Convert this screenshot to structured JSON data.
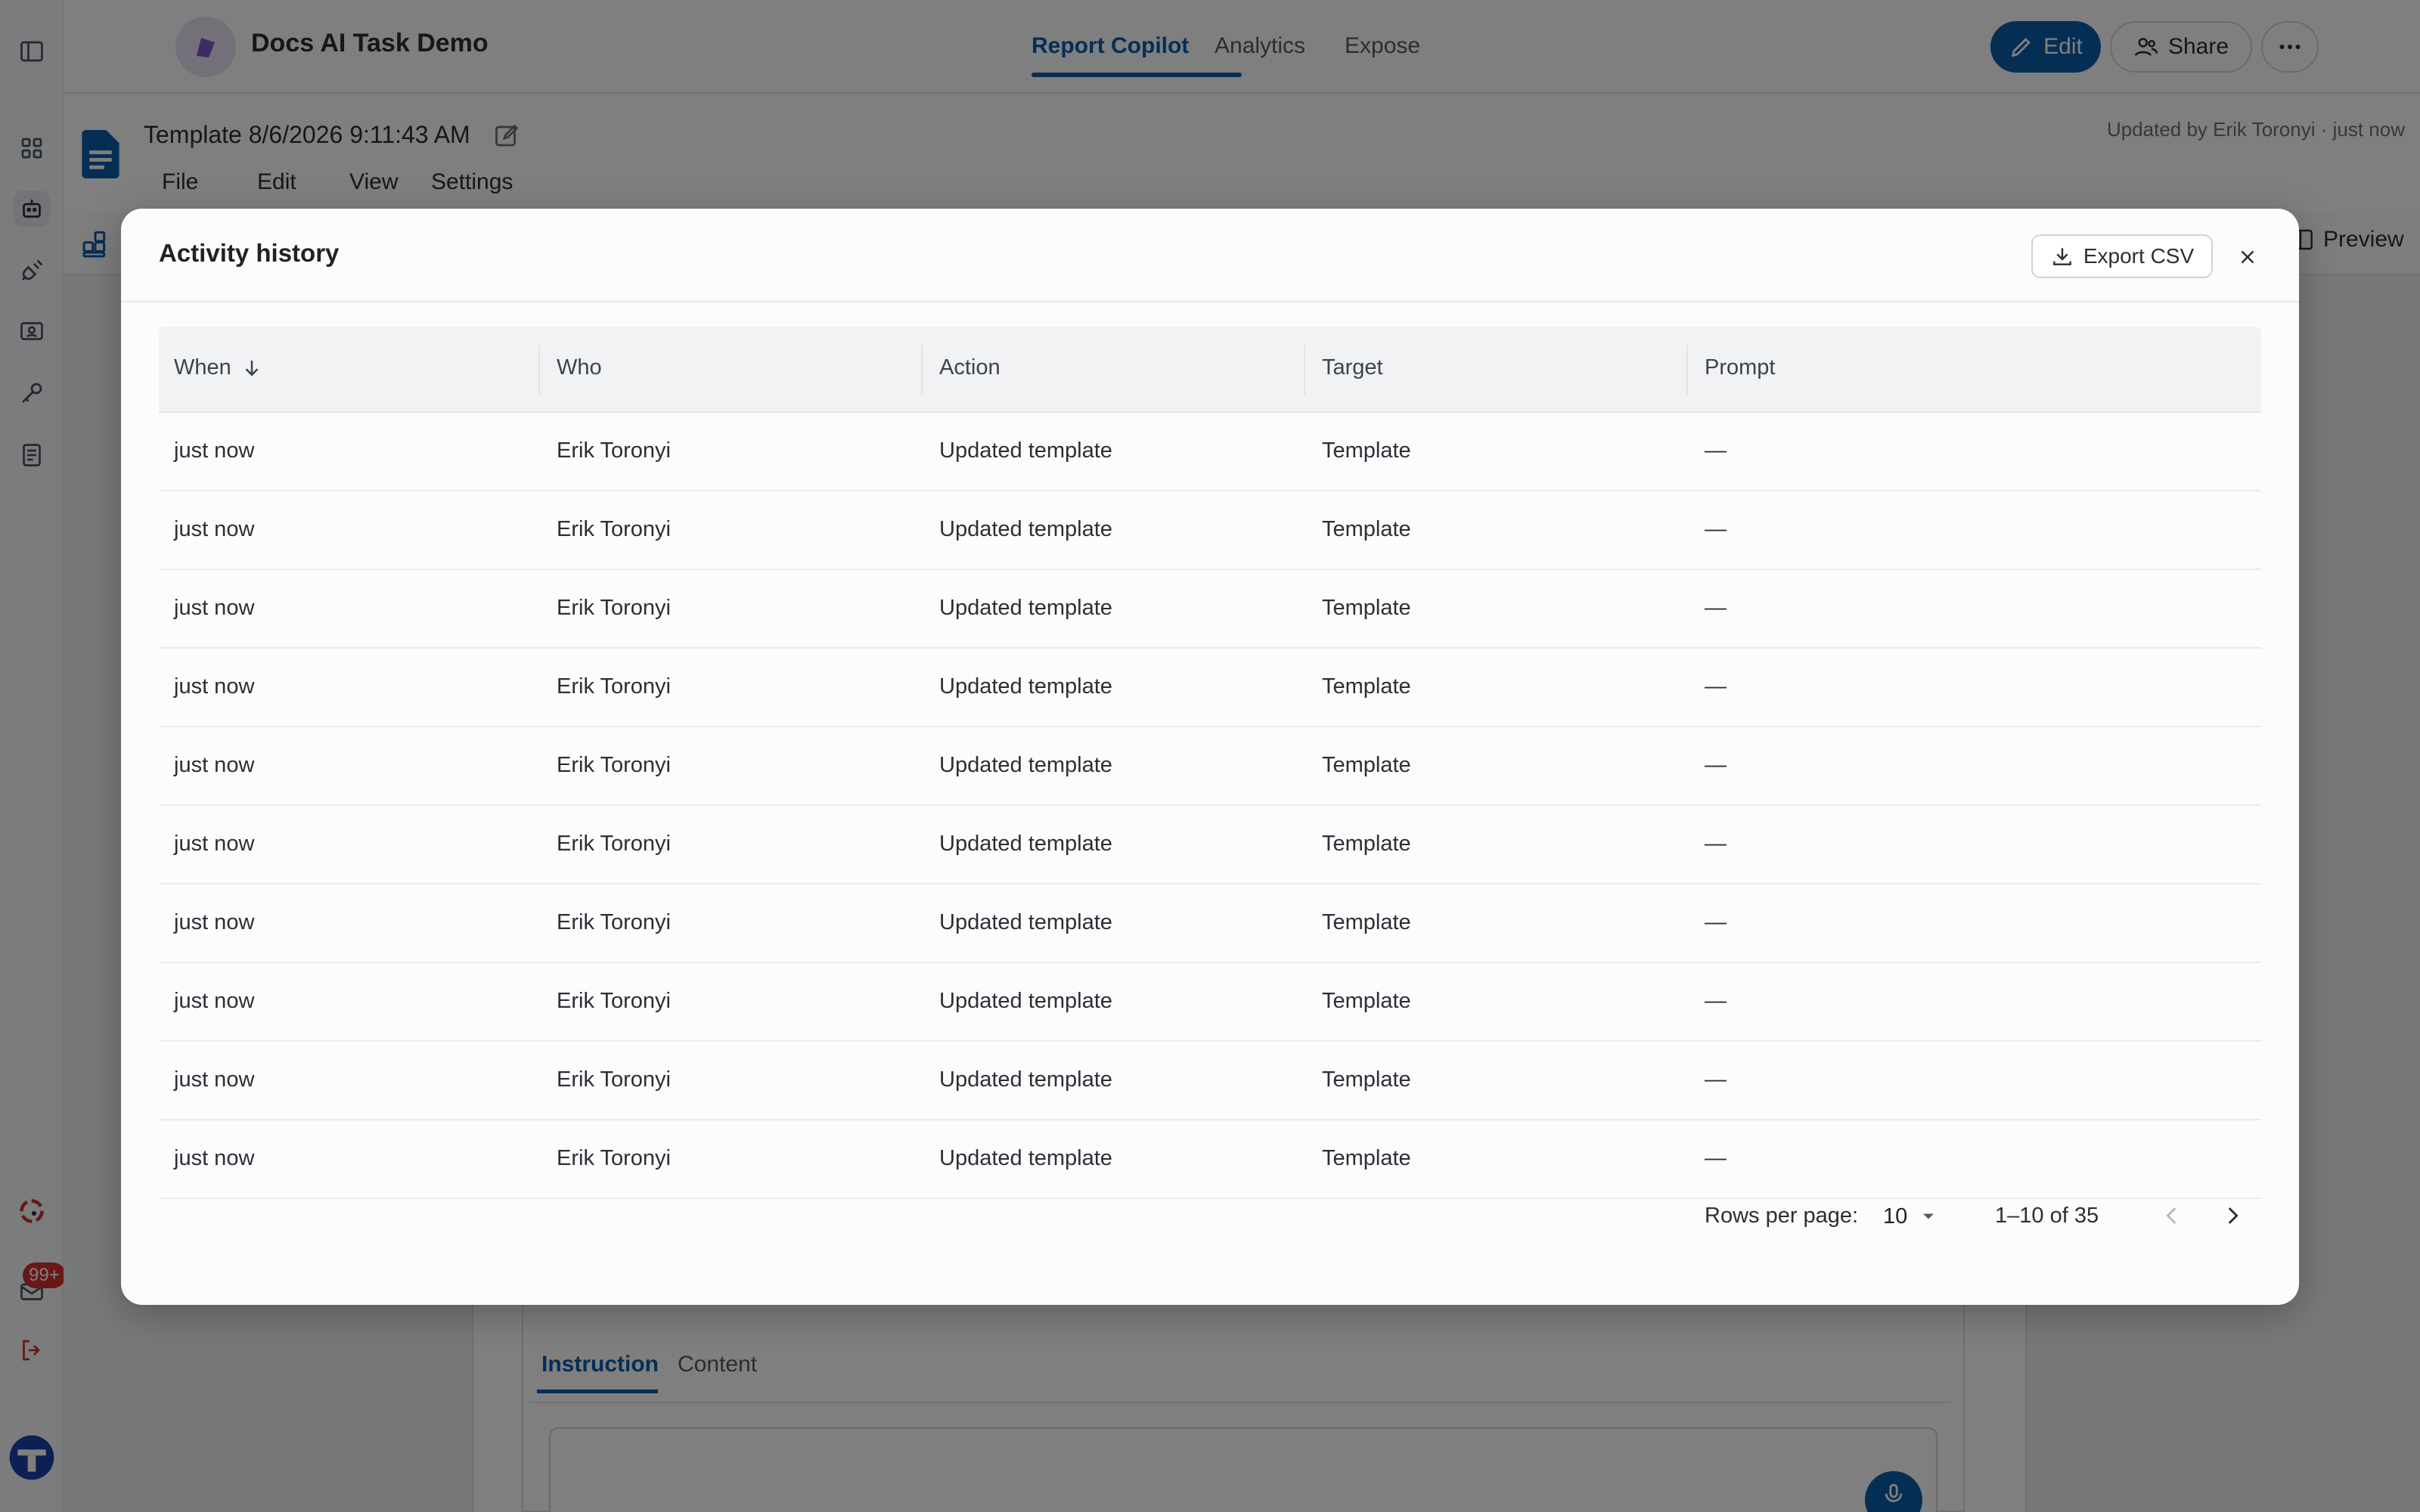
{
  "app": {
    "title": "Docs AI Task Demo",
    "nav_tabs": [
      {
        "label": "Report Copilot",
        "active": true
      },
      {
        "label": "Analytics",
        "active": false
      },
      {
        "label": "Expose",
        "active": false
      }
    ],
    "edit_label": "Edit",
    "share_label": "Share",
    "accent_color": "#0b5cab"
  },
  "rail": {
    "icons": [
      "sidebar-toggle-icon",
      "dashboard-grid-icon",
      "robot-icon",
      "plug-icon",
      "id-card-icon",
      "key-icon",
      "document-list-icon",
      "support-agent-icon",
      "inbox-icon",
      "logout-icon",
      "company-logo"
    ],
    "inbox_badge": "99+"
  },
  "document": {
    "title": "Template 8/6/2026 9:11:43 AM",
    "menu": [
      "File",
      "Edit",
      "View",
      "Settings"
    ],
    "updated": "Updated by Erik Toronyi · just now",
    "preview_label": "Preview"
  },
  "panel": {
    "tabs": [
      {
        "label": "Instruction",
        "active": true
      },
      {
        "label": "Content",
        "active": false
      }
    ]
  },
  "modal": {
    "title": "Activity history",
    "export_label": "Export CSV",
    "columns": [
      "When",
      "Who",
      "Action",
      "Target",
      "Prompt"
    ],
    "sort_column": "When",
    "sort_direction": "descending",
    "rows": [
      [
        "just now",
        "Erik Toronyi",
        "Updated template",
        "Template",
        "—"
      ],
      [
        "just now",
        "Erik Toronyi",
        "Updated template",
        "Template",
        "—"
      ],
      [
        "just now",
        "Erik Toronyi",
        "Updated template",
        "Template",
        "—"
      ],
      [
        "just now",
        "Erik Toronyi",
        "Updated template",
        "Template",
        "—"
      ],
      [
        "just now",
        "Erik Toronyi",
        "Updated template",
        "Template",
        "—"
      ],
      [
        "just now",
        "Erik Toronyi",
        "Updated template",
        "Template",
        "—"
      ],
      [
        "just now",
        "Erik Toronyi",
        "Updated template",
        "Template",
        "—"
      ],
      [
        "just now",
        "Erik Toronyi",
        "Updated template",
        "Template",
        "—"
      ],
      [
        "just now",
        "Erik Toronyi",
        "Updated template",
        "Template",
        "—"
      ],
      [
        "just now",
        "Erik Toronyi",
        "Updated template",
        "Template",
        "—"
      ]
    ],
    "pagination": {
      "rows_per_page_label": "Rows per page:",
      "rows_per_page": "10",
      "range": "1–10 of 35"
    }
  }
}
